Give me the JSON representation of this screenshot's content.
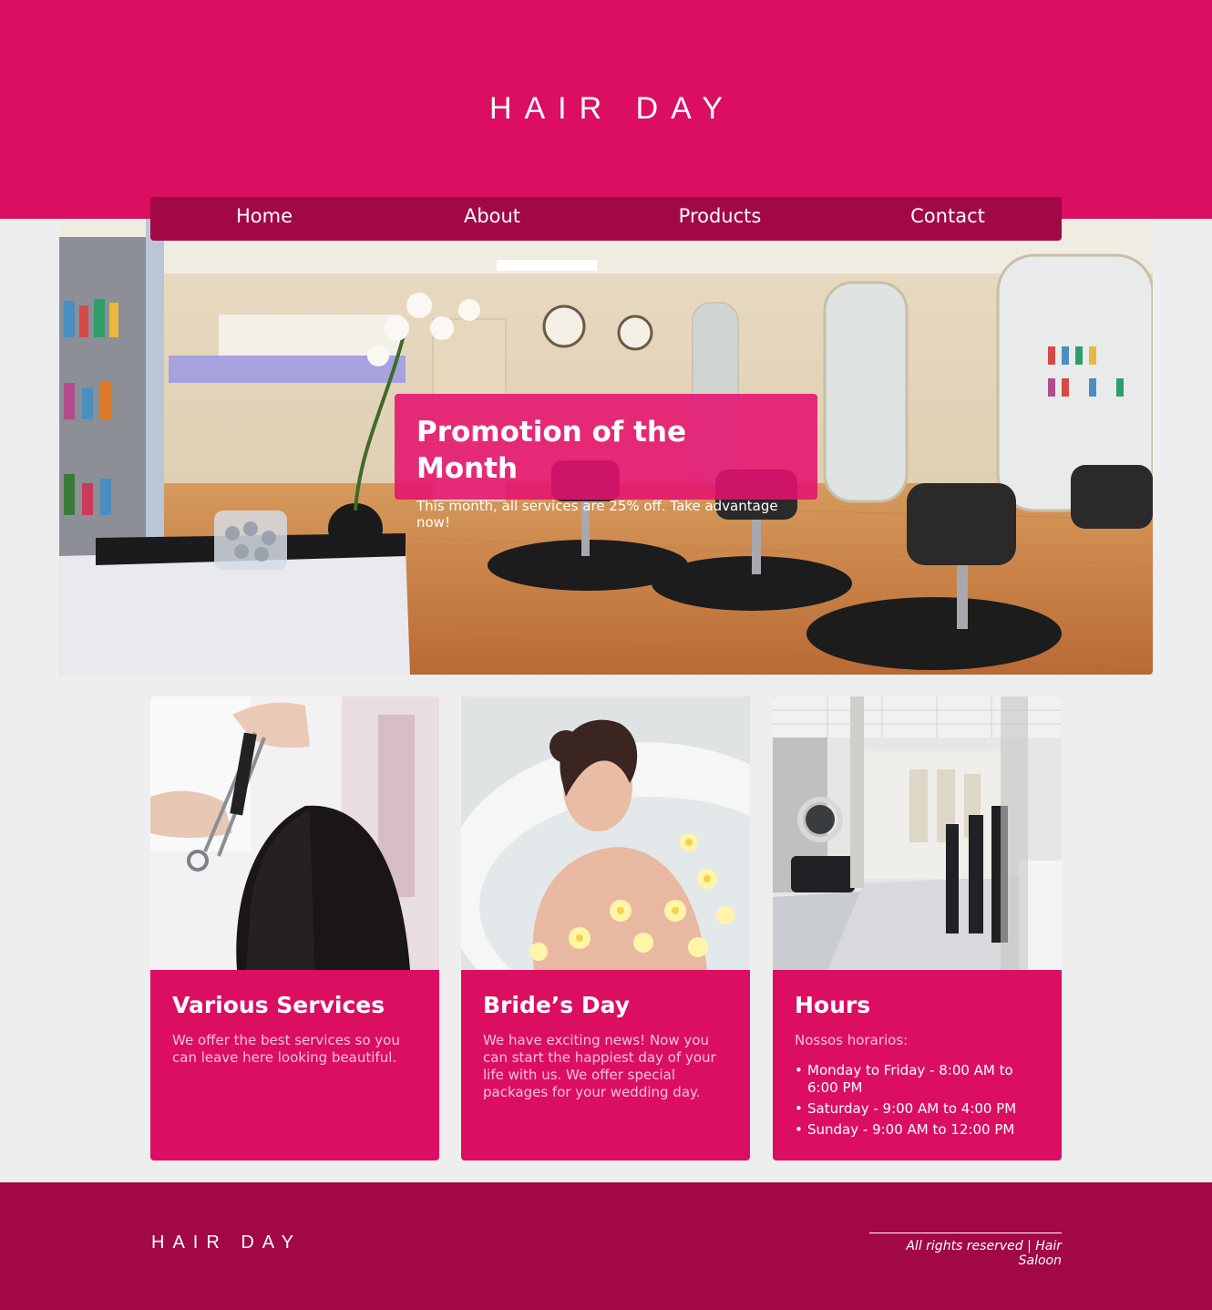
{
  "site": {
    "logo": "HAIR DAY"
  },
  "nav": {
    "items": [
      "Home",
      "About",
      "Products",
      "Contact"
    ]
  },
  "promo": {
    "title": "Promotion of the Month",
    "text": "This month, all services are 25% off. Take advantage now!"
  },
  "cards": [
    {
      "title": "Various Services",
      "text": "We offer the best services so you can leave here looking beautiful."
    },
    {
      "title": "Bride’s Day",
      "text": "We have exciting news! Now you can start the happiest day of your life with us. We offer special packages for your wedding day."
    },
    {
      "title": "Hours",
      "text": "Nossos horarios:",
      "hours": [
        "Monday to Friday - 8:00 AM to 6:00 PM",
        "Saturday - 9:00 AM to 4:00 PM",
        "Sunday - 9:00 AM to 12:00 PM"
      ]
    }
  ],
  "footer": {
    "logo": "HAIR DAY",
    "copyright": "All rights reserved | Hair Saloon"
  },
  "colors": {
    "primary": "#db0e62",
    "dark": "#a10845",
    "background": "#eeeeee"
  }
}
